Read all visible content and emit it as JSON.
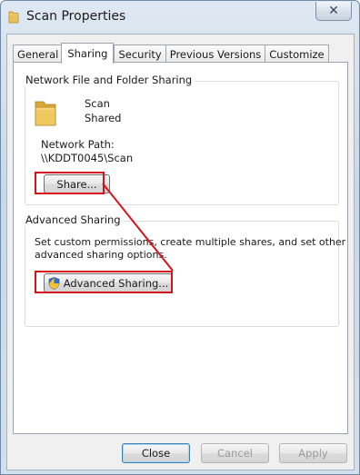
{
  "window": {
    "title": "Scan Properties",
    "close_glyph": "✕"
  },
  "tabs": [
    {
      "label": "General",
      "active": false
    },
    {
      "label": "Sharing",
      "active": true
    },
    {
      "label": "Security",
      "active": false
    },
    {
      "label": "Previous Versions",
      "active": false
    },
    {
      "label": "Customize",
      "active": false
    }
  ],
  "network_sharing": {
    "group_title": "Network File and Folder Sharing",
    "folder_name": "Scan",
    "share_status": "Shared",
    "path_label": "Network Path:",
    "path_value": "\\\\KDDT0045\\Scan",
    "share_button": "Share..."
  },
  "advanced_sharing": {
    "group_title": "Advanced Sharing",
    "description_line1": "Set custom permissions, create multiple shares, and set other",
    "description_line2": "advanced sharing options.",
    "button_label": "Advanced Sharing..."
  },
  "footer": {
    "close_label": "Close",
    "cancel_label": "Cancel",
    "apply_label": "Apply"
  },
  "colors": {
    "highlight": "#d4131c",
    "folder": "#e8c15a"
  },
  "icons": {
    "title": "folder-icon",
    "folder": "folder-icon",
    "advanced_button": "uac-shield-icon",
    "close": "close-icon"
  }
}
